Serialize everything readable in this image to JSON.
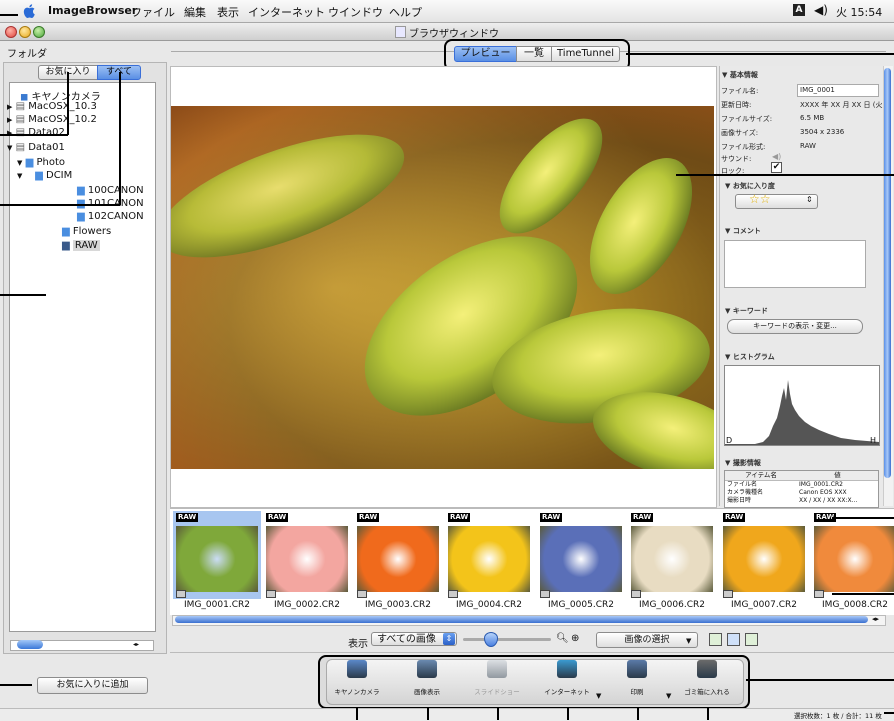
{
  "menubar": {
    "app_name": "ImageBrowser",
    "items": [
      "ファイル",
      "編集",
      "表示",
      "インターネット",
      "ウインドウ",
      "ヘルプ"
    ],
    "clock": "火 15:54",
    "indicator_a": "A"
  },
  "window": {
    "title": "ブラウザウィンドウ"
  },
  "sidebar": {
    "header": "フォルダ",
    "tab_favorites": "お気に入り",
    "tab_all": "すべて",
    "tree": [
      {
        "label": "キヤノンカメラ"
      },
      {
        "label": "MacOSX_10.3"
      },
      {
        "label": "MacOSX_10.2"
      },
      {
        "label": "Data02"
      },
      {
        "label": "Data01"
      },
      {
        "label": "Photo"
      },
      {
        "label": "DCIM"
      },
      {
        "label": "100CANON"
      },
      {
        "label": "101CANON"
      },
      {
        "label": "102CANON"
      },
      {
        "label": "Flowers"
      },
      {
        "label": "RAW"
      }
    ],
    "add_favorite_button": "お気に入りに追加"
  },
  "view_tabs": [
    "プレビュー",
    "一覧",
    "TimeTunnel"
  ],
  "info_panel": {
    "basic_header": "▼ 基本情報",
    "labels": [
      "ファイル名:",
      "更新日時:",
      "ファイルサイズ:",
      "画像サイズ:",
      "ファイル形式:",
      "サウンド:",
      "ロック:"
    ],
    "values": [
      "IMG_0001",
      "XXXX 年 XX 月 XX 日 (火)",
      "6.5 MB",
      "3504 x 2336",
      "RAW"
    ],
    "rating_header": "▼ お気に入り度",
    "rating_stars": "☆☆",
    "comment_header": "▼ コメント",
    "keyword_header": "▼ キーワード",
    "keyword_button": "キーワードの表示・変更...",
    "histogram_header": "▼ ヒストグラム",
    "histogram_left": "D",
    "histogram_right": "H",
    "shooting_header": "▼ 撮影情報",
    "shooting_col_name": "アイテム名",
    "shooting_col_value": "値",
    "shooting_rows": [
      {
        "name": "ファイル名",
        "value": "IMG_0001.CR2"
      },
      {
        "name": "カメラ機種名",
        "value": "Canon EOS XXX"
      },
      {
        "name": "撮影日時",
        "value": "XX / XX / XX  XX:X..."
      }
    ]
  },
  "thumbnails": {
    "badge": "RAW",
    "items": [
      {
        "label": "IMG_0001.CR2",
        "color": "#7fa83a"
      },
      {
        "label": "IMG_0002.CR2",
        "color": "#f3a6a0"
      },
      {
        "label": "IMG_0003.CR2",
        "color": "#f06a1c"
      },
      {
        "label": "IMG_0004.CR2",
        "color": "#f3c41a"
      },
      {
        "label": "IMG_0005.CR2",
        "color": "#5a6fb8"
      },
      {
        "label": "IMG_0006.CR2",
        "color": "#e8dcc2"
      },
      {
        "label": "IMG_0007.CR2",
        "color": "#f0a71c"
      },
      {
        "label": "IMG_0008.CR2",
        "color": "#f08a3c"
      }
    ]
  },
  "view_controls": {
    "label": "表示",
    "filter_select": "すべての画像",
    "select_button": "画像の選択"
  },
  "toolbar": {
    "items": [
      "キヤノンカメラ",
      "画像表示",
      "スライドショー",
      "インターネット",
      "印刷",
      "ゴミ箱に入れる"
    ]
  },
  "status": "選択枚数：1 枚 / 合計：11 枚",
  "colors": {
    "accent_blue": "#3a6fd8",
    "selection": "#a8c6f0",
    "callout": "#000000"
  }
}
